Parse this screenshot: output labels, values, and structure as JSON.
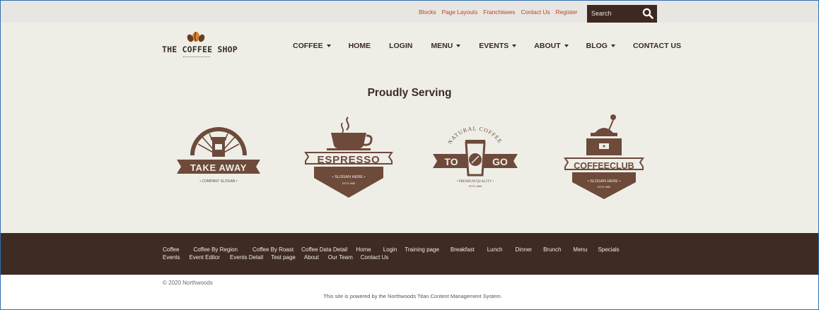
{
  "top_links": [
    "Blocks",
    "Page Layouts",
    "Franchisees",
    "Contact Us",
    "Register"
  ],
  "search": {
    "placeholder": "Search",
    "icon": "search-icon"
  },
  "logo": {
    "name": "THE COFFEE SHOP"
  },
  "nav": [
    {
      "label": "COFFEE",
      "dropdown": true
    },
    {
      "label": "HOME",
      "dropdown": false
    },
    {
      "label": "LOGIN",
      "dropdown": false
    },
    {
      "label": "MENU",
      "dropdown": true
    },
    {
      "label": "EVENTS",
      "dropdown": true
    },
    {
      "label": "ABOUT",
      "dropdown": true
    },
    {
      "label": "BLOG",
      "dropdown": true
    },
    {
      "label": "CONTACT US",
      "dropdown": false
    }
  ],
  "hero": {
    "heading": "Proudly Serving"
  },
  "badges": [
    {
      "title": "TAKE AWAY",
      "slogan": "• COMPANY SLOGAN •"
    },
    {
      "title": "ESPRESSO",
      "slogan": "• SLOGAN HERE •",
      "sub": "ESTD 1888"
    },
    {
      "title_left": "TO",
      "title_right": "GO",
      "arc": "NATURAL COFFEE",
      "slogan": "• PREMIUM QUALITY •",
      "sub": "ESTD 1888"
    },
    {
      "title": "COFFEECLUB",
      "slogan": "• SLOGAN HERE •",
      "sub": "ESTD 1888"
    }
  ],
  "footer": {
    "row1": [
      "Coffee",
      "Coffee By Region",
      "Coffee By Roast",
      "Coffee Data Detail",
      "Home",
      "Login",
      "Training page",
      "Breakfast",
      "Lunch",
      "Dinner",
      "Brunch",
      "Menu",
      "Specials"
    ],
    "row2": [
      "Events",
      "Event Editor",
      "Events Detail",
      "Test page",
      "About",
      "Our Team",
      "Contact Us"
    ]
  },
  "copyright": "© 2020 Northwoods",
  "powered_by": "This site is powered by the Northwoods Titan Content Management System.",
  "colors": {
    "brown": "#3d2b24",
    "cream": "#eeeee7",
    "link": "#b04a2b",
    "badge_brown": "#6e4a3b"
  }
}
